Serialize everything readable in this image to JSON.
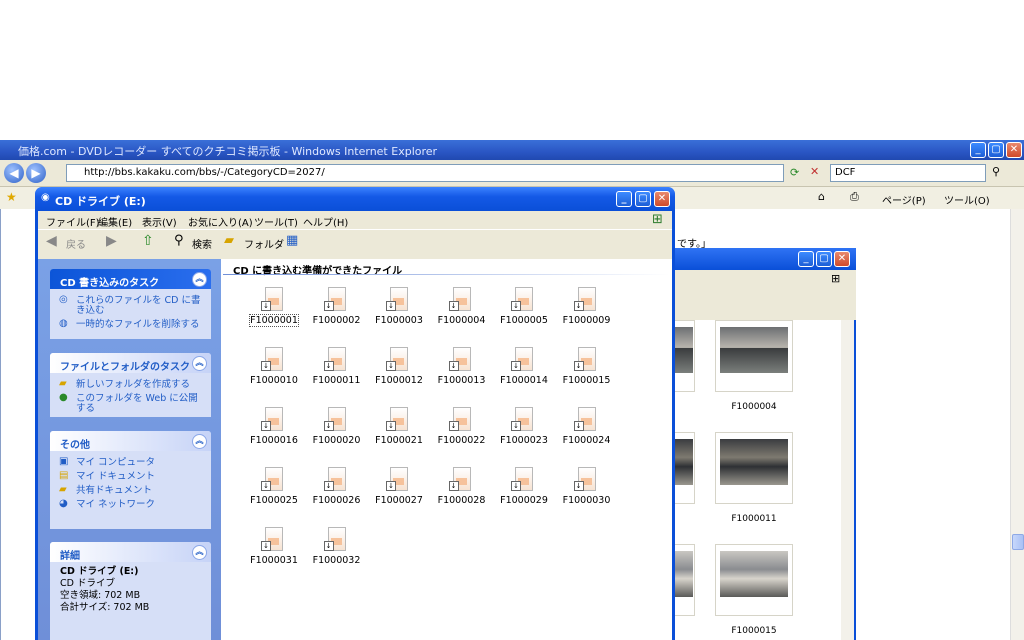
{
  "ie": {
    "title": "価格.com - DVDレコーダー すべてのクチコミ掲示板 - Windows Internet Explorer",
    "url": "http://bbs.kakaku.com/bbs/-/CategoryCD=2027/",
    "search_value": "DCF",
    "page_menu": "ページ(P)",
    "tools_menu": "ツール(O)",
    "page_snippet": "です。」"
  },
  "cd_window": {
    "title": "CD ドライブ (E:)",
    "menu": [
      "ファイル(F)",
      "編集(E)",
      "表示(V)",
      "お気に入り(A)",
      "ツール(T)",
      "ヘルプ(H)"
    ],
    "toolbar": {
      "back": "戻る",
      "search": "検索",
      "folders": "フォルダ"
    },
    "section_title": "CD に書き込む準備ができたファイル",
    "panels": {
      "cd_tasks": {
        "title": "CD 書き込みのタスク",
        "items": [
          "これらのファイルを CD に書き込む",
          "一時的なファイルを削除する"
        ]
      },
      "file_tasks": {
        "title": "ファイルとフォルダのタスク",
        "items": [
          "新しいフォルダを作成する",
          "このフォルダを Web に公開する"
        ]
      },
      "other": {
        "title": "その他",
        "items": [
          "マイ コンピュータ",
          "マイ ドキュメント",
          "共有ドキュメント",
          "マイ ネットワーク"
        ]
      },
      "details": {
        "title": "詳細",
        "name": "CD ドライブ (E:)",
        "type": "CD ドライブ",
        "free": "空き領域: 702 MB",
        "total": "合計サイズ: 702 MB"
      }
    },
    "files": [
      "F1000001",
      "F1000002",
      "F1000003",
      "F1000004",
      "F1000005",
      "F1000009",
      "F1000010",
      "F1000011",
      "F1000012",
      "F1000013",
      "F1000014",
      "F1000015",
      "F1000016",
      "F1000020",
      "F1000021",
      "F1000022",
      "F1000023",
      "F1000024",
      "F1000025",
      "F1000026",
      "F1000027",
      "F1000028",
      "F1000029",
      "F1000030",
      "F1000031",
      "F1000032"
    ]
  },
  "photo_window": {
    "thumbs": [
      "F1000004",
      "F1000011",
      "F1000015"
    ]
  }
}
